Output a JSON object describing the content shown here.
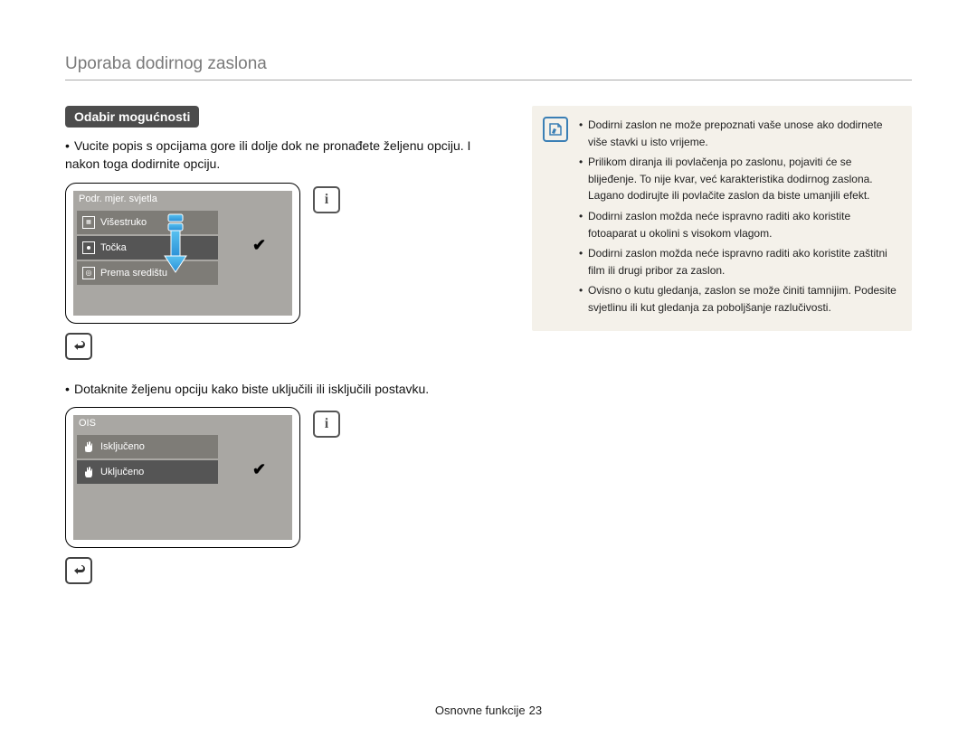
{
  "header": {
    "title": "Uporaba dodirnog zaslona"
  },
  "section": {
    "heading": "Odabir mogućnosti"
  },
  "bullets": {
    "b1": "Vucite popis s opcijama gore ili dolje dok ne pronađete željenu opciju. I nakon toga dodirnite opciju.",
    "b2": "Dotaknite željenu opciju kako biste uključili ili isključili postavku."
  },
  "screen1": {
    "title": "Podr. mjer. svjetla",
    "rows": [
      "Višestruko",
      "Točka",
      "Prema središtu"
    ],
    "selected_index": 1
  },
  "screen2": {
    "title": "OIS",
    "rows": [
      "Isključeno",
      "Uključeno"
    ],
    "selected_index": 1
  },
  "icons": {
    "info": "i",
    "back": "↵",
    "check": "✔"
  },
  "notes": [
    "Dodirni zaslon ne može prepoznati vaše unose ako dodirnete više stavki u isto vrijeme.",
    "Prilikom diranja ili povlačenja po zaslonu, pojaviti će se blijeđenje. To nije kvar, već karakteristika dodirnog zaslona. Lagano dodirujte ili povlačite zaslon da biste umanjili efekt.",
    "Dodirni zaslon možda neće ispravno raditi ako koristite fotoaparat u okolini s visokom vlagom.",
    "Dodirni zaslon možda neće ispravno raditi ako koristite zaštitni film ili drugi pribor za zaslon.",
    "Ovisno o kutu gledanja, zaslon se može činiti tamnijim. Podesite svjetlinu ili kut gledanja za poboljšanje razlučivosti."
  ],
  "footer": {
    "label": "Osnovne funkcije",
    "page": "23"
  }
}
